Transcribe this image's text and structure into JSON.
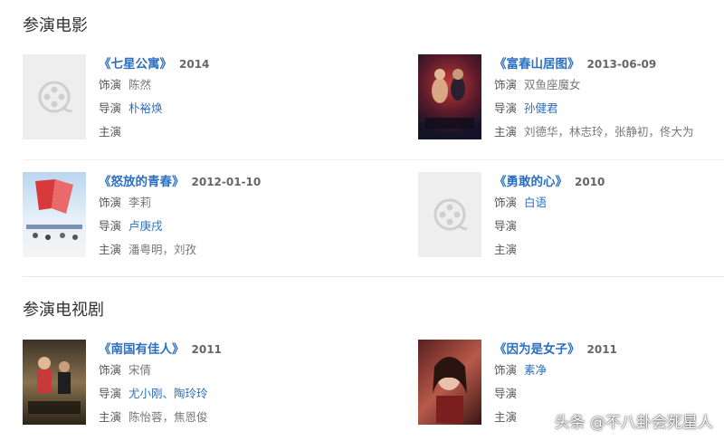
{
  "sections": {
    "movies": {
      "title": "参演电影"
    },
    "tv": {
      "title": "参演电视剧"
    }
  },
  "labels": {
    "role": "饰演",
    "director": "导演",
    "cast": "主演"
  },
  "cards": [
    {
      "title": "《七星公寓》",
      "year": "2014",
      "role": "陈然",
      "director": "朴裕焕",
      "cast": "",
      "poster": "placeholder"
    },
    {
      "title": "《富春山居图》",
      "year": "2013-06-09",
      "role": "双鱼座魔女",
      "director": "孙健君",
      "cast": "刘德华，林志玲，张静初，佟大为",
      "poster": "image",
      "poster_text": "富春山居图"
    },
    {
      "title": "《怒放的青春》",
      "year": "2012-01-10",
      "role": "李莉",
      "director": "卢庚戌",
      "cast": "潘粤明，刘孜",
      "poster": "image"
    },
    {
      "title": "《勇敢的心》",
      "year": "2010",
      "role": "白语",
      "director": "",
      "cast": "",
      "poster": "placeholder"
    },
    {
      "title": "《南国有佳人》",
      "year": "2011",
      "role": "宋倩",
      "director": "尤小刚、陶玲玲",
      "cast": "陈怡蓉，焦恩俊",
      "poster": "image"
    },
    {
      "title": "《因为是女子》",
      "year": "2011",
      "role": "素净",
      "director": "",
      "cast": "",
      "poster": "image"
    }
  ],
  "watermark": "头条 @不八卦会死星人",
  "colors": {
    "link": "#2b6fc2",
    "text": "#666666",
    "placeholder_bg": "#eeeeee"
  }
}
